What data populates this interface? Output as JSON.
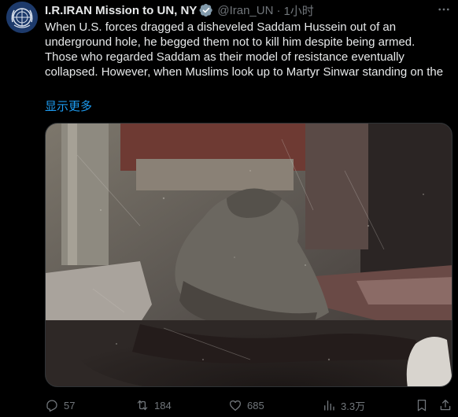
{
  "post": {
    "author": {
      "display_name": "I.R.IRAN Mission to UN, NY",
      "handle": "@Iran_UN",
      "separator": "·",
      "time": "1小时"
    },
    "text": "When U.S. forces dragged a disheveled Saddam Hussein out of an underground hole, he begged them not to kill him despite being armed. Those who regarded Saddam as their model of resistance eventually collapsed. However, when Muslims look up to Martyr Sinwar standing on the",
    "show_more": "显示更多",
    "metrics": {
      "replies": "57",
      "reposts": "184",
      "likes": "685",
      "views": "3.3万"
    }
  },
  "colors": {
    "background": "#000000",
    "text_primary": "#e7e9ea",
    "text_secondary": "#71767b",
    "link": "#1d9bf0",
    "verified_badge": "#829aab"
  },
  "icons": {
    "avatar": "un-emblem-icon",
    "verified": "verified-badge-icon",
    "more": "more-icon",
    "reply": "reply-icon",
    "repost": "repost-icon",
    "like": "heart-icon",
    "views": "views-icon",
    "bookmark": "bookmark-icon",
    "share": "share-icon"
  }
}
